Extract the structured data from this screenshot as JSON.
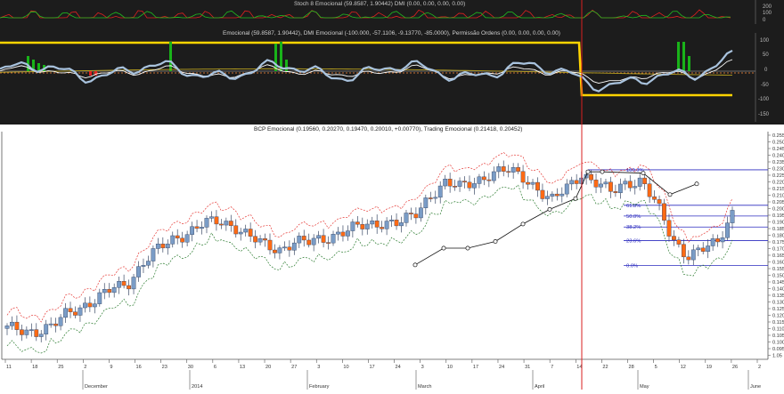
{
  "panes": {
    "stoch": {
      "title": "Stoch 8 Emocional (59.8587, 1.90442) DMI (0.00, 0.00, 0.00, 0.00)",
      "ticks": [
        "200",
        "100",
        "0"
      ]
    },
    "emo": {
      "title": "Emocional (59.8587, 1.90442), DMI Emocional (-100.000, -57.1106, -9.13770, -85.0000), Permissão Ordens (0.00, 0.00, 0.00, 0.00)",
      "ticks": [
        "100",
        "50",
        "0",
        "-50",
        "-100",
        "-150"
      ]
    },
    "price": {
      "title": "BCP Emocional (0.19560, 0.20270, 0.19470, 0.20010, +0.00770), Trading Emocional (0.21418, 0.20452)"
    }
  },
  "fib_labels": [
    "100.0%",
    "61.8%",
    "50.0%",
    "38.2%",
    "23.6%",
    "0.0%"
  ],
  "colors": {
    "bull": "#7a9cc6",
    "bear": "#ff6a14",
    "accent_yellow": "#ffd400",
    "cursor": "#d81f1f",
    "fib": "#2b2bbf"
  },
  "chart_data": {
    "type": "candlestick",
    "title": "BCP Emocional (0.19560, 0.20270, 0.19470, 0.20010, +0.00770), Trading Emocional (0.21418, 0.20452)",
    "ylim": [
      0.09,
      0.26
    ],
    "yticks": [
      "0.255",
      "0.250",
      "0.245",
      "0.240",
      "0.235",
      "0.230",
      "0.225",
      "0.220",
      "0.215",
      "0.210",
      "0.205",
      "0.200",
      "0.195",
      "0.190",
      "0.185",
      "0.180",
      "0.175",
      "0.170",
      "0.165",
      "0.160",
      "0.155",
      "0.150",
      "0.145",
      "0.140",
      "0.135",
      "0.130",
      "0.125",
      "0.120",
      "0.115",
      "0.110",
      "0.105",
      "0.100",
      "0.095",
      "1.05"
    ],
    "xticks": [
      "11",
      "18",
      "25",
      "2",
      "9",
      "16",
      "23",
      "30",
      "6",
      "13",
      "20",
      "27",
      "3",
      "10",
      "17",
      "24",
      "3",
      "10",
      "17",
      "24",
      "31",
      "7",
      "14",
      "22",
      "28",
      "5",
      "12",
      "19",
      "26",
      "2"
    ],
    "months": [
      "December",
      "2014",
      "February",
      "March",
      "April",
      "May",
      "June"
    ],
    "fibonacci": [
      {
        "label": "100.0%",
        "value": 0.2315
      },
      {
        "label": "61.8%",
        "value": 0.205
      },
      {
        "label": "50.0%",
        "value": 0.197
      },
      {
        "label": "38.2%",
        "value": 0.1888
      },
      {
        "label": "23.6%",
        "value": 0.1786
      },
      {
        "label": "0.0%",
        "value": 0.16
      }
    ],
    "trading_emocional": [
      0.1605,
      0.173,
      0.173,
      0.178,
      0.191,
      0.202,
      0.21,
      0.23,
      0.23,
      0.229,
      0.213,
      0.221
    ],
    "close": [
      0.113,
      0.112,
      0.111,
      0.114,
      0.125,
      0.13,
      0.135,
      0.143,
      0.147,
      0.162,
      0.172,
      0.18,
      0.185,
      0.191,
      0.193,
      0.19,
      0.182,
      0.175,
      0.172,
      0.178,
      0.177,
      0.18,
      0.185,
      0.188,
      0.19,
      0.193,
      0.192,
      0.197,
      0.213,
      0.222,
      0.218,
      0.223,
      0.229,
      0.231,
      0.227,
      0.219,
      0.208,
      0.217,
      0.229,
      0.222,
      0.214,
      0.222,
      0.224,
      0.205,
      0.18,
      0.168,
      0.172,
      0.176,
      0.2
    ]
  }
}
